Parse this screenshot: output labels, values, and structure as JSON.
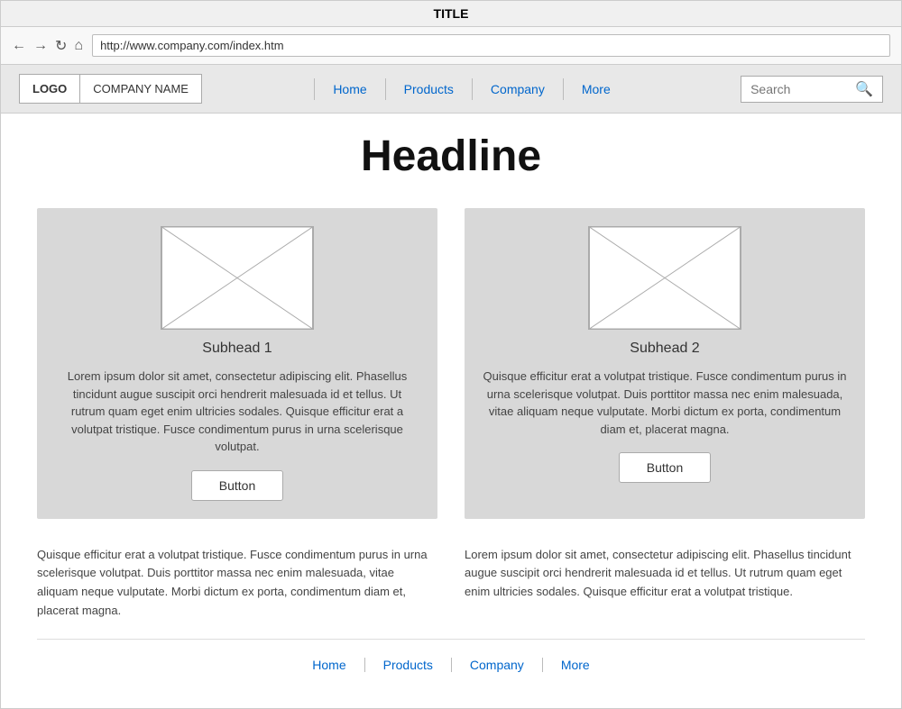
{
  "browser": {
    "title": "TITLE",
    "url": "http://www.company.com/index.htm"
  },
  "header": {
    "logo_label": "LOGO",
    "company_name": "COMPANY NAME",
    "nav_links": [
      {
        "label": "Home",
        "href": "#"
      },
      {
        "label": "Products",
        "href": "#"
      },
      {
        "label": "Company",
        "href": "#"
      },
      {
        "label": "More",
        "href": "#"
      }
    ],
    "search_placeholder": "Search"
  },
  "main": {
    "headline": "Headline",
    "cards": [
      {
        "subhead": "Subhead 1",
        "body": "Lorem ipsum dolor sit amet, consectetur adipiscing elit. Phasellus tincidunt augue suscipit orci hendrerit malesuada id et tellus. Ut rutrum quam eget enim ultricies sodales. Quisque efficitur erat a volutpat tristique. Fusce condimentum purus in urna scelerisque volutpat.",
        "button_label": "Button"
      },
      {
        "subhead": "Subhead 2",
        "body": "Quisque efficitur erat a volutpat tristique. Fusce condimentum purus in urna scelerisque volutpat. Duis porttitor massa nec enim malesuada, vitae aliquam neque vulputate. Morbi dictum ex porta, condimentum diam et, placerat magna.",
        "button_label": "Button"
      }
    ],
    "body_texts": [
      "Quisque efficitur erat a volutpat tristique. Fusce condimentum purus in urna scelerisque volutpat. Duis porttitor massa nec enim malesuada, vitae aliquam neque vulputate. Morbi dictum ex porta, condimentum diam et, placerat magna.",
      "Lorem ipsum dolor sit amet, consectetur adipiscing elit. Phasellus tincidunt augue suscipit orci hendrerit malesuada id et tellus. Ut rutrum quam eget enim ultricies sodales. Quisque efficitur erat a volutpat tristique."
    ]
  },
  "footer": {
    "nav_links": [
      {
        "label": "Home",
        "href": "#"
      },
      {
        "label": "Products",
        "href": "#"
      },
      {
        "label": "Company",
        "href": "#"
      },
      {
        "label": "More",
        "href": "#"
      }
    ]
  }
}
